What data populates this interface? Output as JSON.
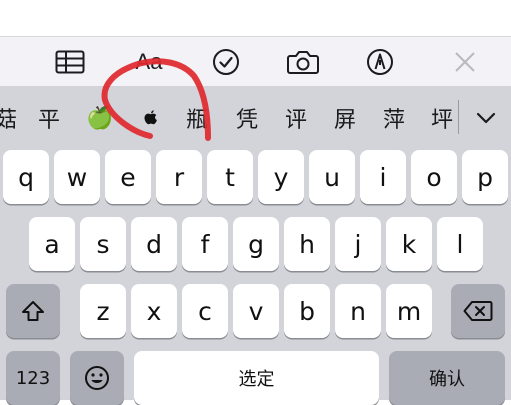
{
  "toolbar": {
    "items": [
      {
        "name": "table-icon"
      },
      {
        "name": "text-format",
        "label": "Aa"
      },
      {
        "name": "checkmark-circle-icon"
      },
      {
        "name": "camera-icon"
      },
      {
        "name": "markup-pen-icon"
      },
      {
        "name": "close-icon"
      }
    ]
  },
  "candidates": {
    "items": [
      "菇",
      "平",
      "🍏",
      "",
      "瓶",
      "凭",
      "评",
      "屏",
      "萍",
      "坪"
    ],
    "apple_logo_icon": "apple-logo-icon",
    "expand_icon": "chevron-down-icon"
  },
  "keyboard": {
    "row1": [
      "q",
      "w",
      "e",
      "r",
      "t",
      "y",
      "u",
      "i",
      "o",
      "p"
    ],
    "row2": [
      "a",
      "s",
      "d",
      "f",
      "g",
      "h",
      "j",
      "k",
      "l"
    ],
    "row3": [
      "z",
      "x",
      "c",
      "v",
      "b",
      "n",
      "m"
    ],
    "numbers_key": "123",
    "space_key": "选定",
    "return_key": "确认",
    "shift_icon": "shift-icon",
    "delete_icon": "delete-backspace-icon",
    "emoji_icon": "emoji-icon"
  },
  "colors": {
    "keyboard_bg": "#d3d4da",
    "key_bg": "#ffffff",
    "function_key_bg": "#a9acb5",
    "toolbar_bg": "#f3f2f6",
    "annotation_red": "#e0282e"
  }
}
